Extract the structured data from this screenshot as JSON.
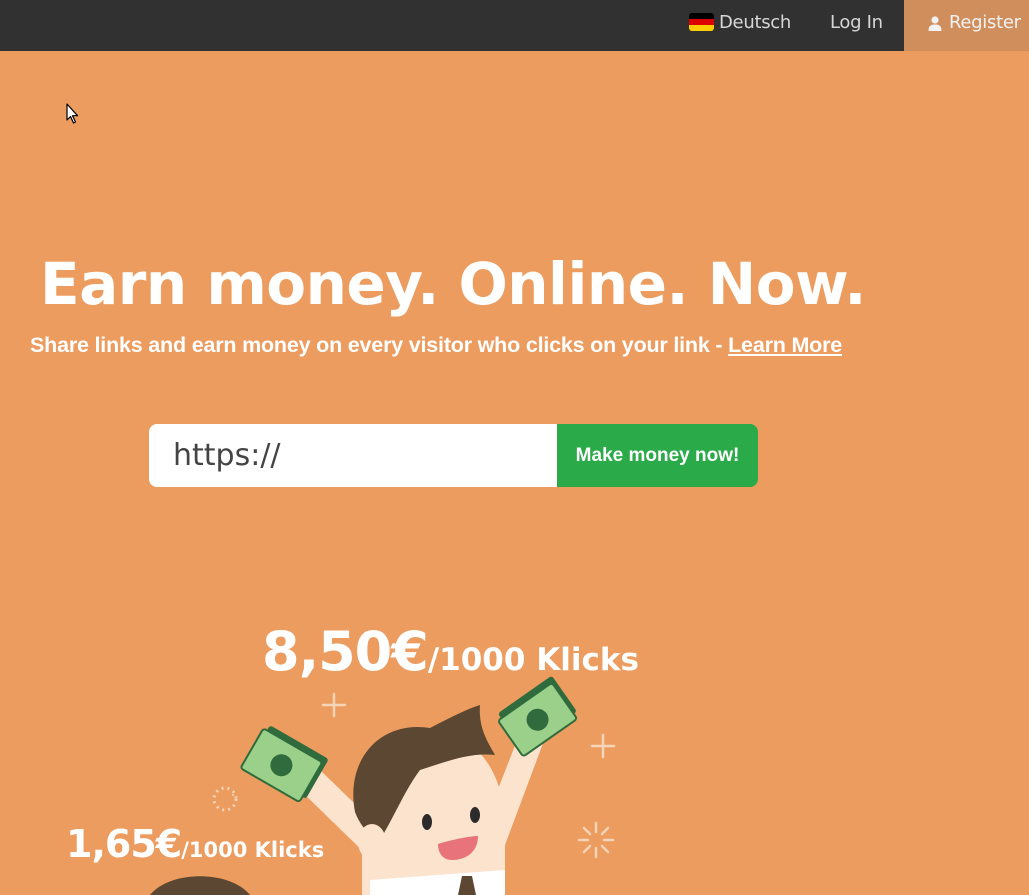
{
  "nav": {
    "language_label": "Deutsch",
    "language_icon": "german-flag-icon",
    "login_label": "Log In",
    "register_label": "Register",
    "register_icon": "user-icon"
  },
  "hero": {
    "title": "Earn money. Online. Now.",
    "subtitle": "Share links and earn money on every visitor who clicks on your link - ",
    "learn_more": "Learn More"
  },
  "form": {
    "url_value": "https://",
    "submit_label": "Make money now!"
  },
  "rates": {
    "main_amount": "8,50€",
    "main_unit": "/1000 Klicks",
    "small_amount": "1,65€",
    "small_unit": "/1000 Klicks"
  },
  "colors": {
    "background": "#ec9c5e",
    "topbar": "#313131",
    "register_bg": "#d08e5c",
    "cta_green": "#2aaa48"
  }
}
